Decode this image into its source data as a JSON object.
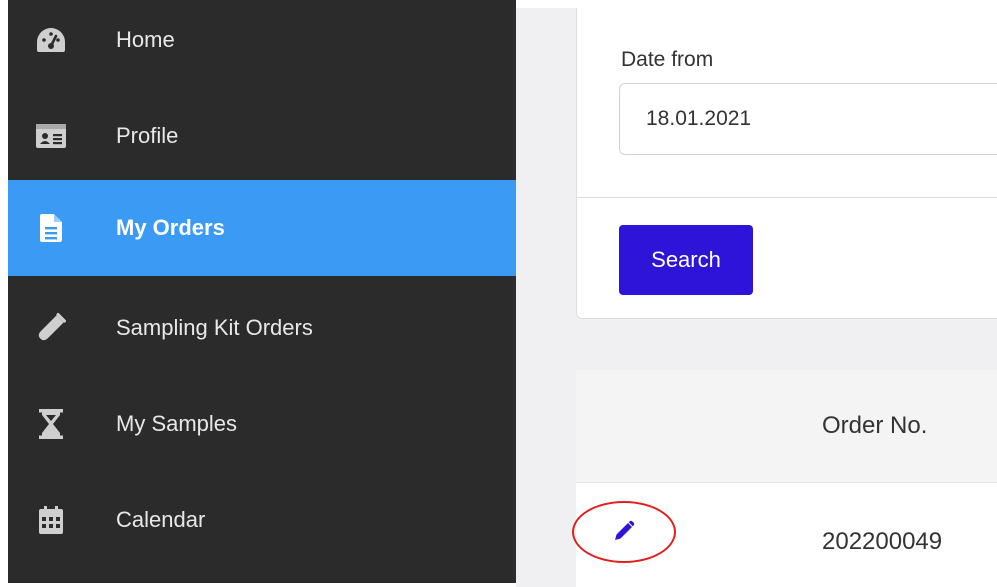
{
  "sidebar": {
    "items": [
      {
        "label": "Home",
        "icon": "dashboard-icon",
        "active": false
      },
      {
        "label": "Profile",
        "icon": "id-card-icon",
        "active": false
      },
      {
        "label": "My Orders",
        "icon": "document-icon",
        "active": true
      },
      {
        "label": "Sampling Kit Orders",
        "icon": "test-tube-icon",
        "active": false
      },
      {
        "label": "My Samples",
        "icon": "hourglass-icon",
        "active": false
      },
      {
        "label": "Calendar",
        "icon": "calendar-icon",
        "active": false
      }
    ]
  },
  "filters": {
    "date_from_label": "Date from",
    "date_from_value": "18.01.2021",
    "search_label": "Search"
  },
  "orders_table": {
    "columns": [
      "Order No."
    ],
    "rows": [
      {
        "order_no": "202200049"
      }
    ]
  },
  "colors": {
    "sidebar_bg": "#2b2b2b",
    "active_item": "#3a9af4",
    "search_button": "#2d14d8",
    "edit_icon": "#2d14d8",
    "highlight_ring": "#e0201c"
  }
}
